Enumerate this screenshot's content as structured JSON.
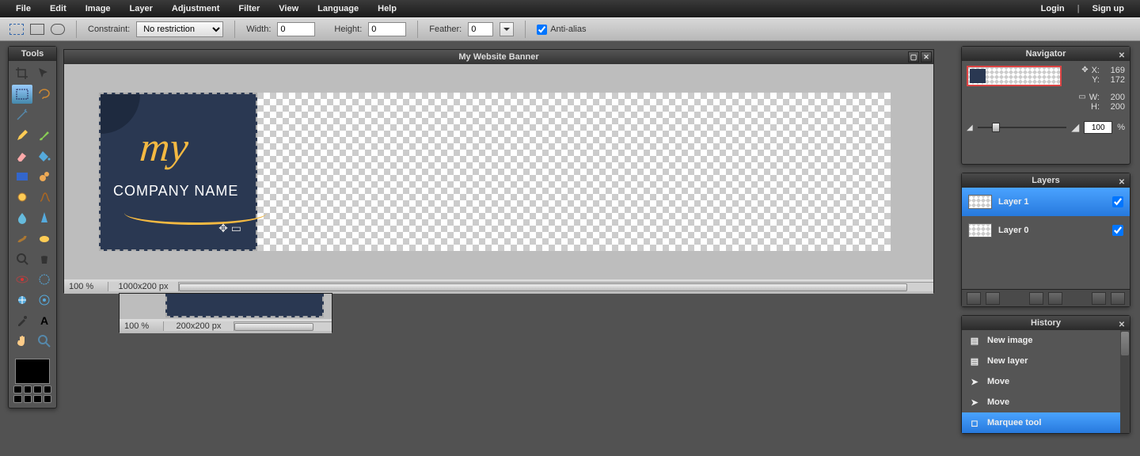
{
  "menu": {
    "items": [
      "File",
      "Edit",
      "Image",
      "Layer",
      "Adjustment",
      "Filter",
      "View",
      "Language",
      "Help"
    ],
    "login": "Login",
    "signup": "Sign up"
  },
  "options": {
    "constraint_label": "Constraint:",
    "constraint_value": "No restriction",
    "width_label": "Width:",
    "width_value": "0",
    "height_label": "Height:",
    "height_value": "0",
    "feather_label": "Feather:",
    "feather_value": "0",
    "antialias_label": "Anti-alias"
  },
  "tools": {
    "title": "Tools"
  },
  "canvas1": {
    "title": "My Website Banner",
    "zoom": "100",
    "zoom_unit": "%",
    "dims": "1000x200 px",
    "logo_my": "my",
    "logo_company": "COMPANY NAME"
  },
  "canvas2": {
    "zoom": "100",
    "zoom_unit": "%",
    "dims": "200x200 px"
  },
  "navigator": {
    "title": "Navigator",
    "x_label": "X:",
    "x_val": "169",
    "y_label": "Y:",
    "y_val": "172",
    "w_label": "W:",
    "w_val": "200",
    "h_label": "H:",
    "h_val": "200",
    "zoom": "100",
    "zoom_unit": "%"
  },
  "layers": {
    "title": "Layers",
    "items": [
      "Layer 1",
      "Layer 0"
    ]
  },
  "history": {
    "title": "History",
    "items": [
      "New image",
      "New layer",
      "Move",
      "Move",
      "Marquee tool"
    ]
  }
}
